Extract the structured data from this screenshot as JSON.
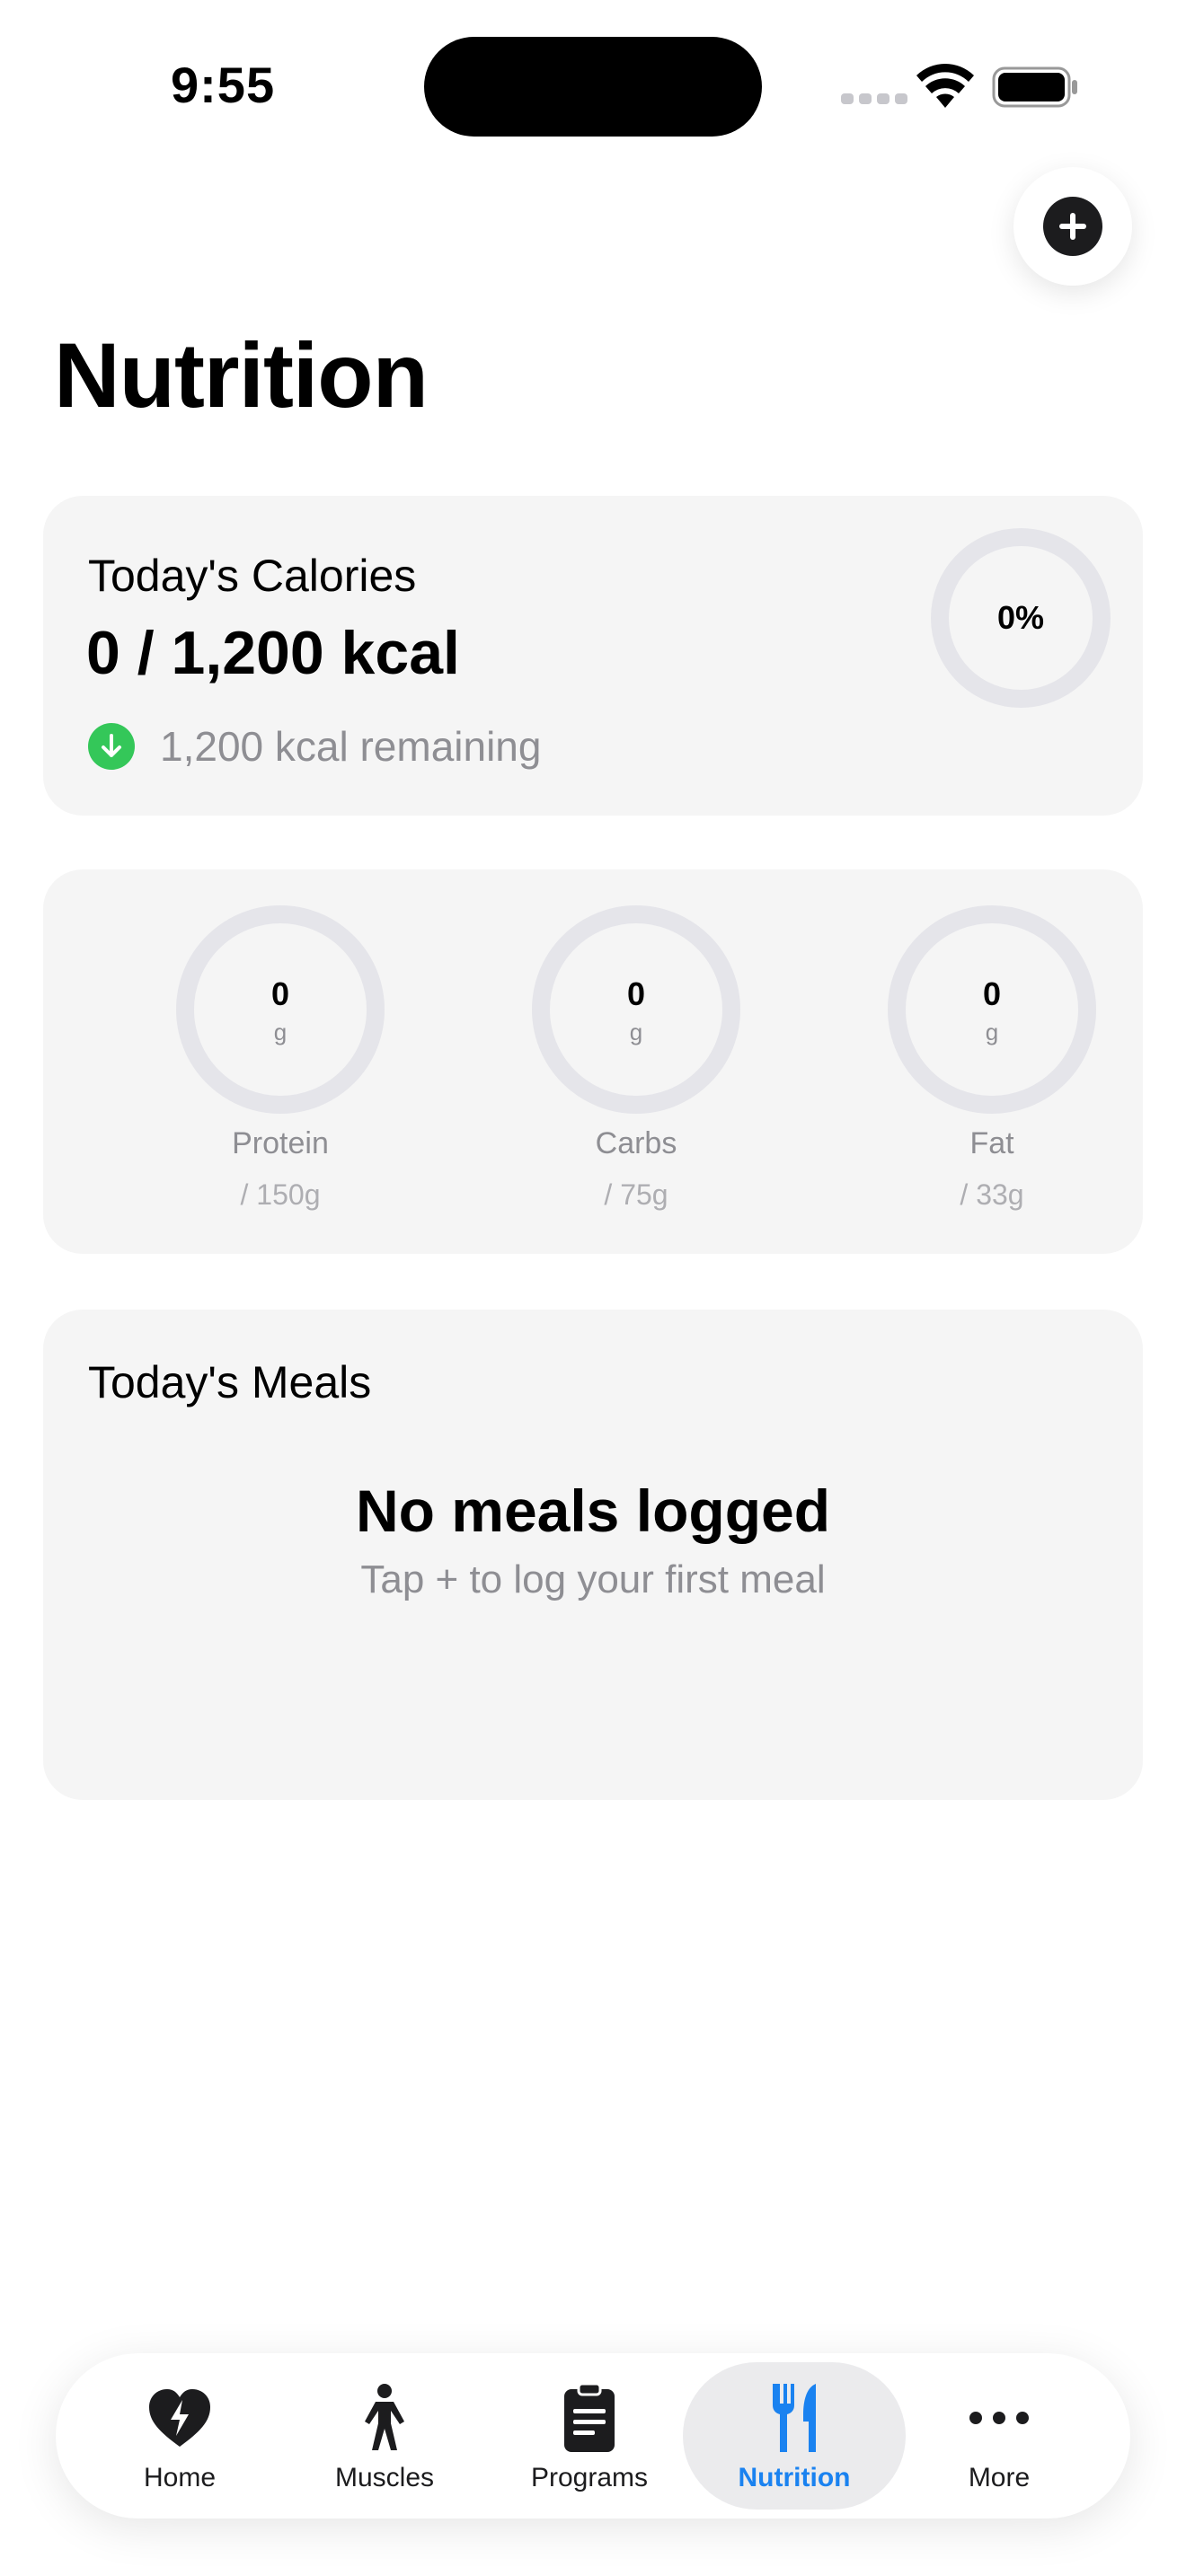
{
  "status_bar": {
    "time": "9:55"
  },
  "header": {
    "title": "Nutrition",
    "add_icon": "plus-circle-icon"
  },
  "calories": {
    "label": "Today's Calories",
    "value": "0 / 1,200 kcal",
    "remaining": "1,200 kcal remaining",
    "percent": "0%",
    "progress": 0,
    "accent": "#34c759"
  },
  "macros": [
    {
      "value": "0",
      "unit": "g",
      "name": "Protein",
      "goal": "/ 150g",
      "progress": 0
    },
    {
      "value": "0",
      "unit": "g",
      "name": "Carbs",
      "goal": "/ 75g",
      "progress": 0
    },
    {
      "value": "0",
      "unit": "g",
      "name": "Fat",
      "goal": "/ 33g",
      "progress": 0
    }
  ],
  "meals": {
    "title": "Today's Meals",
    "empty_title": "No meals logged",
    "empty_subtitle": "Tap + to log your first meal"
  },
  "tabs": [
    {
      "label": "Home",
      "icon": "heart-bolt-icon",
      "active": false
    },
    {
      "label": "Muscles",
      "icon": "figure-icon",
      "active": false
    },
    {
      "label": "Programs",
      "icon": "clipboard-icon",
      "active": false
    },
    {
      "label": "Nutrition",
      "icon": "fork-knife-icon",
      "active": true
    },
    {
      "label": "More",
      "icon": "more-icon",
      "active": false
    }
  ],
  "colors": {
    "active_tab": "#1a82f0",
    "ring_track": "#e5e5ea",
    "card_bg": "#f5f5f5"
  }
}
